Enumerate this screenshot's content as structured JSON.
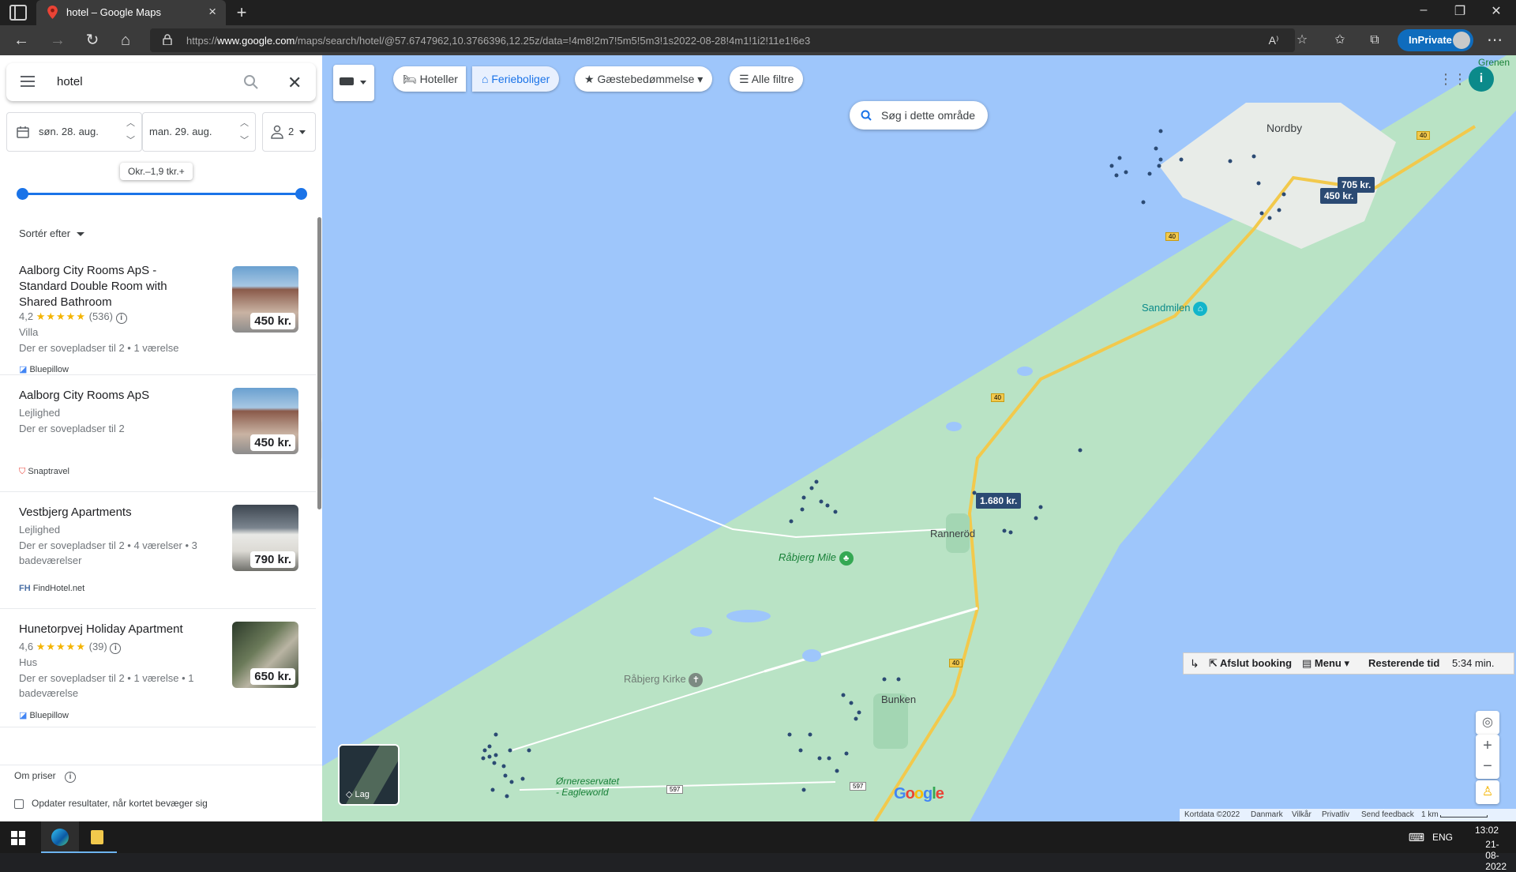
{
  "browser": {
    "tab_title": "hotel – Google Maps",
    "url_prefix": "https://",
    "url_domain": "www.google.com",
    "url_rest": "/maps/search/hotel/@57.6747962,10.3766396,12.25z/data=!4m8!2m7!5m5!5m3!1s2022-08-28!4m1!1i2!11e1!6e3",
    "inprivate_label": "InPrivate"
  },
  "panel": {
    "search_value": "hotel",
    "checkin": "søn. 28. aug.",
    "checkout": "man. 29. aug.",
    "guests": "2",
    "price_range": "Okr.–1,9 tkr.+",
    "sort_label": "Sortér efter",
    "about_prices": "Om priser",
    "update_results": "Opdater resultater, når kortet bevæger sig"
  },
  "results": [
    {
      "name": "Aalborg City Rooms ApS - Standard Double Room with Shared Bathroom",
      "rating": "4,2",
      "stars": "★★★★★",
      "reviews": "(536)",
      "type": "Villa",
      "details": "Der er sovepladser til 2 • 1 værelse",
      "source": "Bluepillow",
      "price": "450 kr."
    },
    {
      "name": "Aalborg City Rooms ApS",
      "type": "Lejlighed",
      "details": "Der er sovepladser til 2",
      "source": "Snaptravel",
      "price": "450 kr."
    },
    {
      "name": "Vestbjerg Apartments",
      "type": "Lejlighed",
      "details": "Der er sovepladser til 2 • 4 værelser • 3 badeværelser",
      "source": "FindHotel.net",
      "price": "790 kr."
    },
    {
      "name": "Hunetorpvej Holiday Apartment",
      "rating": "4,6",
      "stars": "★★★★★",
      "reviews": "(39)",
      "type": "Hus",
      "details": "Der er sovepladser til 2 • 1 værelse • 1 badeværelse",
      "source": "Bluepillow",
      "price": "650 kr."
    }
  ],
  "map": {
    "chips": {
      "hotels": "Hoteller",
      "vacation": "Ferieboliger",
      "rating": "Gæstebedømmelse",
      "filters": "Alle filtre"
    },
    "search_area": "Søg i dette område",
    "places": {
      "nordby": "Nordby",
      "sandmilen": "Sandmilen",
      "rannerod": "Ranneröd",
      "rabjerg_mile": "Råbjerg Mile",
      "rabjerg_kirke": "Råbjerg Kirke",
      "bunken": "Bunken",
      "ornereservatet": "Ørnereservatet\n- Eagleworld",
      "grenen": "Grenen"
    },
    "pins": {
      "p1": "705 kr.",
      "p2": "450 kr.",
      "p3": "1.680 kr."
    },
    "roads": {
      "r40": "40",
      "r597": "597"
    },
    "booking": {
      "finish": "Afslut booking",
      "menu": "Menu",
      "remaining_label": "Resterende tid",
      "remaining_value": "5:34 min."
    },
    "layer_label": "Lag",
    "footer": {
      "mapdata": "Kortdata ©2022",
      "country": "Danmark",
      "terms": "Vilkår",
      "privacy": "Privatliv",
      "feedback": "Send feedback",
      "scale": "1 km"
    },
    "logo": "Google"
  },
  "taskbar": {
    "lang": "ENG",
    "time": "13:02",
    "date": "21-08-2022"
  },
  "colors": {
    "land": "#b9e3c5",
    "water": "#9ec6fb",
    "accent": "#1a73e8",
    "pin": "#2b4a73"
  }
}
